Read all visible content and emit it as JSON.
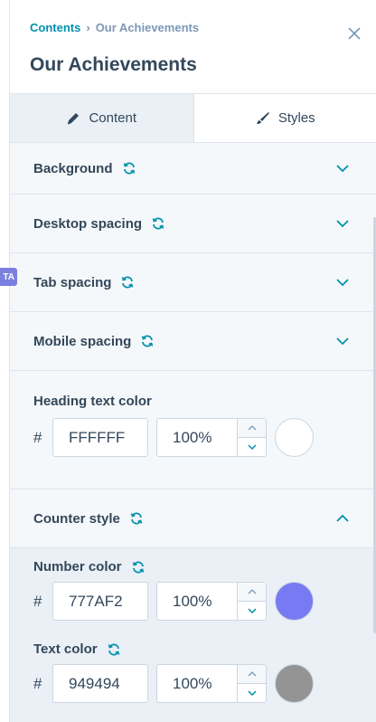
{
  "breadcrumb": {
    "parent": "Contents",
    "separator": "›",
    "current": "Our Achievements"
  },
  "title": "Our Achievements",
  "tabs": [
    {
      "label": "Content",
      "icon": "pencil-icon",
      "active": false
    },
    {
      "label": "Styles",
      "icon": "brush-icon",
      "active": true
    }
  ],
  "side_badge": "TA",
  "sections": [
    {
      "label": "Background",
      "expanded": false
    },
    {
      "label": "Desktop spacing",
      "expanded": false
    },
    {
      "label": "Tab spacing",
      "expanded": false
    },
    {
      "label": "Mobile spacing",
      "expanded": false
    }
  ],
  "heading_color": {
    "label": "Heading text color",
    "hash": "#",
    "hex": "FFFFFF",
    "opacity": "100%",
    "swatch": "#ffffff"
  },
  "counter_style": {
    "label": "Counter style",
    "expanded": true
  },
  "number_color": {
    "label": "Number color",
    "hash": "#",
    "hex": "777AF2",
    "opacity": "100%",
    "swatch": "#777af2"
  },
  "text_color": {
    "label": "Text color",
    "hash": "#",
    "hex": "949494",
    "opacity": "100%",
    "swatch": "#949494"
  },
  "colors": {
    "accent": "#0091ae",
    "text": "#33475b",
    "border": "#cbd6e2",
    "panel_bg": "#f5f8fa",
    "tab_inactive_bg": "#eaf0f6"
  }
}
